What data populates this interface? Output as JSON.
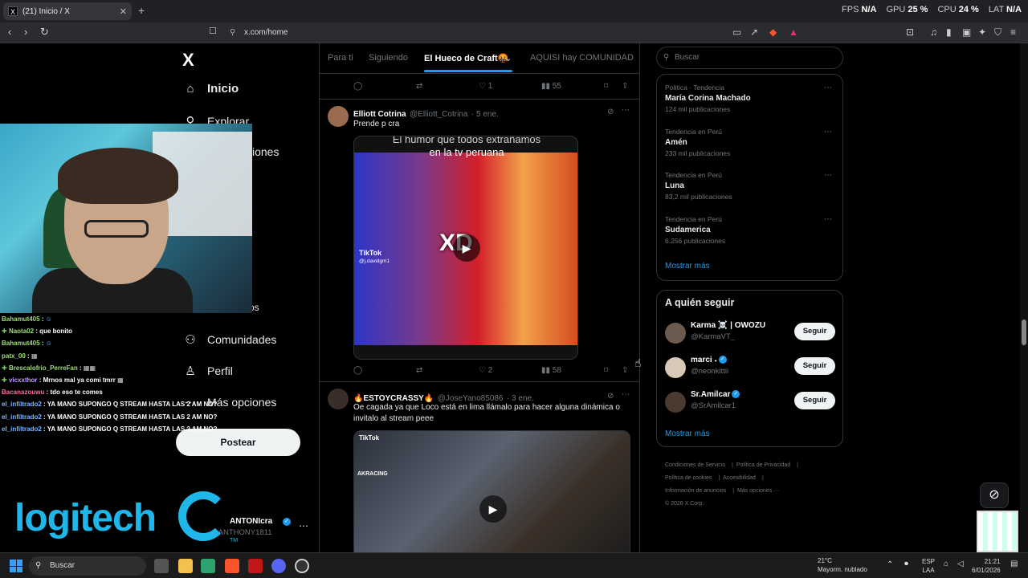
{
  "browser": {
    "tab_title": "(21) Inicio / X",
    "tab_favicon": "X",
    "url": "x.com/home",
    "stats": [
      {
        "label": "FPS",
        "value": "N/A"
      },
      {
        "label": "GPU",
        "value": "25 %"
      },
      {
        "label": "CPU",
        "value": "24 %"
      },
      {
        "label": "LAT",
        "value": "N/A"
      }
    ]
  },
  "left_nav": {
    "logo": "X",
    "items": [
      {
        "icon": "home-icon",
        "label": "Inicio"
      },
      {
        "icon": "search-icon",
        "label": "Explorar"
      },
      {
        "icon": "bell-icon",
        "label": "Notificaciones"
      },
      {
        "icon": "bookmark-icon",
        "label": "Guardados"
      },
      {
        "icon": "communities-icon",
        "label": "Comunidades"
      },
      {
        "icon": "person-icon",
        "label": "Perfil"
      },
      {
        "icon": "more-icon",
        "label": "Más opciones"
      }
    ],
    "visible_fragments": {
      "explorar": "Explorar",
      "notif": "iones",
      "guardados": "os"
    },
    "post_button": "Postear",
    "account": {
      "name": "ANTONIcra",
      "handle": "@ANTHONY1811"
    }
  },
  "chat": [
    {
      "user": "Bahamut405",
      "text": ":"
    },
    {
      "user": "Naota02",
      "text": ": que bonito"
    },
    {
      "user": "Bahamut405",
      "text": ":"
    },
    {
      "user": "patx_00",
      "text": ":"
    },
    {
      "user": "Brescalofrio_PerreFan",
      "text": ":"
    },
    {
      "user": "vicxxthor",
      "text": ": Mrnos mal ya comi tmrr"
    },
    {
      "user": "Bacanazouwu",
      "text": ": tdo eso te comes"
    },
    {
      "user": "el_infiltrado2",
      "text": ": YA MANO SUPONGO Q STREAM HASTA LAS 2 AM NO?"
    },
    {
      "user": "el_infiltrado2",
      "text": ": YA MANO SUPONGO Q STREAM HASTA LAS 2 AM NO?"
    },
    {
      "user": "el_infiltrado2",
      "text": ": YA MANO SUPONGO Q STREAM HASTA LAS 2 AM NO?"
    }
  ],
  "sponsor": {
    "brand": "logitech",
    "tm": "TM"
  },
  "timeline": {
    "tabs": [
      "Para ti",
      "Siguiendo",
      "El Hueco de Craft🤬",
      "AQUISI hay COMUNIDAD"
    ],
    "active_tab": 2,
    "top_actions": {
      "likes": "1",
      "views": "55"
    },
    "tweets": [
      {
        "name": "Elliott Cotrina",
        "handle": "@Elliott_Cotrina",
        "date": "· 5 ene.",
        "text": "Prende p cra",
        "media_caption_1": "El humor que todos extrañamos",
        "media_caption_2": "en la tv peruana",
        "media_overlay": "XD",
        "tiktok_label": "TikTok",
        "tiktok_user": "@j.davidgm1",
        "likes": "2",
        "views": "58"
      },
      {
        "name": "ESTOYCRASSY",
        "handle": "@JoseYano85086",
        "date": "· 3 ene.",
        "text": "Oe cagada ya que Loco está en lima llámalo para hacer alguna dinámica o invitalo al stream peee",
        "tiktok_label": "TikTok",
        "media_brand": "AKRACING"
      }
    ]
  },
  "right": {
    "search_placeholder": "Buscar",
    "trends": [
      {
        "category": "Política · Tendencia",
        "name": "María Corina Machado",
        "count": "124 mil publicaciones"
      },
      {
        "category": "Tendencia en Perú",
        "name": "Amén",
        "count": "233 mil publicaciones"
      },
      {
        "category": "Tendencia en Perú",
        "name": "Luna",
        "count": "83,2 mil publicaciones"
      },
      {
        "category": "Tendencia en Perú",
        "name": "Sudamerica",
        "count": "6.256 publicaciones"
      }
    ],
    "show_more": "Mostrar más",
    "who_to_follow_title": "A quién seguir",
    "who_to_follow": [
      {
        "name": "Karma ☠️ | OWOZU",
        "handle": "@KarmaVT_",
        "verified": false,
        "button": "Seguir"
      },
      {
        "name": "marci 𝆺",
        "handle": "@neonkittii",
        "verified": true,
        "button": "Seguir"
      },
      {
        "name": "Sr.Amilcar",
        "handle": "@SrAmilcar1",
        "verified": true,
        "button": "Seguir"
      }
    ],
    "show_more_2": "Mostrar más",
    "footer": [
      "Condiciones de Servicio",
      "Política de Privacidad",
      "Política de cookies",
      "Accesibilidad",
      "Información de anuncios",
      "Más opciones ···",
      "© 2026 X Corp."
    ]
  },
  "taskbar": {
    "search": "Buscar",
    "weather_temp": "21°C",
    "weather_desc": "Mayorm. nublado",
    "lang_1": "ESP",
    "lang_2": "LAA",
    "time": "21:21",
    "date": "6/01/2026"
  },
  "colors": {
    "accent": "#1d9bf0",
    "logitech": "#1fb7ea",
    "border": "#2f3336"
  }
}
